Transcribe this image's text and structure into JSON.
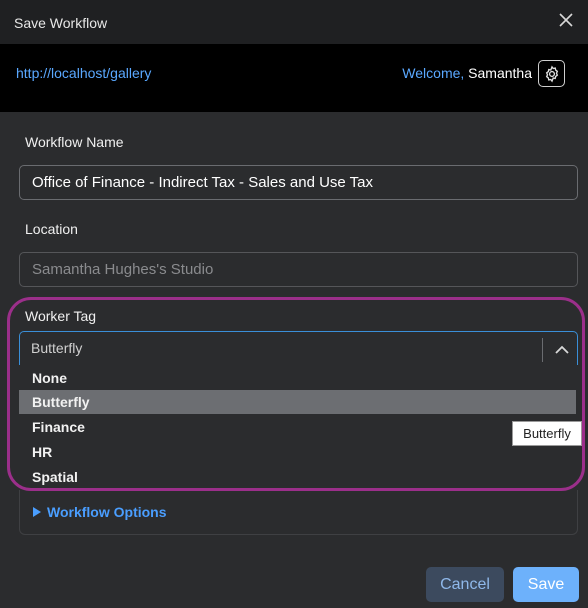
{
  "window": {
    "title": "Save Workflow"
  },
  "header": {
    "url": "http://localhost/gallery",
    "welcome": "Welcome,",
    "user": "Samantha"
  },
  "form": {
    "workflow_name_label": "Workflow Name",
    "workflow_name_value": "Office of Finance - Indirect Tax - Sales and Use Tax",
    "location_label": "Location",
    "location_value": "Samantha Hughes's Studio",
    "worker_tag_label": "Worker Tag",
    "worker_tag_value": "Butterfly",
    "worker_tag_options": [
      "None",
      "Butterfly",
      "Finance",
      "HR",
      "Spatial"
    ],
    "tooltip": "Butterfly",
    "workflow_options_label": "Workflow Options"
  },
  "footer": {
    "cancel_label": "Cancel",
    "save_label": "Save"
  },
  "colors": {
    "accent": "#4a9eff",
    "highlight_ring": "#9b2f8a",
    "save_button": "#6db1fb"
  }
}
